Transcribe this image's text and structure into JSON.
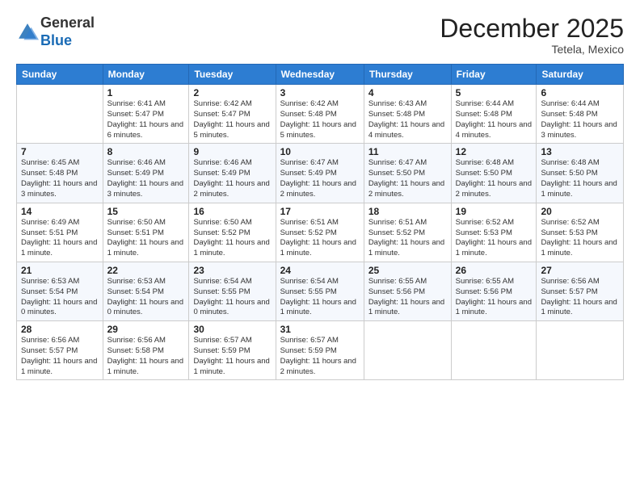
{
  "logo": {
    "general": "General",
    "blue": "Blue"
  },
  "header": {
    "month": "December 2025",
    "location": "Tetela, Mexico"
  },
  "weekdays": [
    "Sunday",
    "Monday",
    "Tuesday",
    "Wednesday",
    "Thursday",
    "Friday",
    "Saturday"
  ],
  "weeks": [
    [
      {
        "day": "",
        "sunrise": "",
        "sunset": "",
        "daylight": ""
      },
      {
        "day": "1",
        "sunrise": "Sunrise: 6:41 AM",
        "sunset": "Sunset: 5:47 PM",
        "daylight": "Daylight: 11 hours and 6 minutes."
      },
      {
        "day": "2",
        "sunrise": "Sunrise: 6:42 AM",
        "sunset": "Sunset: 5:47 PM",
        "daylight": "Daylight: 11 hours and 5 minutes."
      },
      {
        "day": "3",
        "sunrise": "Sunrise: 6:42 AM",
        "sunset": "Sunset: 5:48 PM",
        "daylight": "Daylight: 11 hours and 5 minutes."
      },
      {
        "day": "4",
        "sunrise": "Sunrise: 6:43 AM",
        "sunset": "Sunset: 5:48 PM",
        "daylight": "Daylight: 11 hours and 4 minutes."
      },
      {
        "day": "5",
        "sunrise": "Sunrise: 6:44 AM",
        "sunset": "Sunset: 5:48 PM",
        "daylight": "Daylight: 11 hours and 4 minutes."
      },
      {
        "day": "6",
        "sunrise": "Sunrise: 6:44 AM",
        "sunset": "Sunset: 5:48 PM",
        "daylight": "Daylight: 11 hours and 3 minutes."
      }
    ],
    [
      {
        "day": "7",
        "sunrise": "Sunrise: 6:45 AM",
        "sunset": "Sunset: 5:48 PM",
        "daylight": "Daylight: 11 hours and 3 minutes."
      },
      {
        "day": "8",
        "sunrise": "Sunrise: 6:46 AM",
        "sunset": "Sunset: 5:49 PM",
        "daylight": "Daylight: 11 hours and 3 minutes."
      },
      {
        "day": "9",
        "sunrise": "Sunrise: 6:46 AM",
        "sunset": "Sunset: 5:49 PM",
        "daylight": "Daylight: 11 hours and 2 minutes."
      },
      {
        "day": "10",
        "sunrise": "Sunrise: 6:47 AM",
        "sunset": "Sunset: 5:49 PM",
        "daylight": "Daylight: 11 hours and 2 minutes."
      },
      {
        "day": "11",
        "sunrise": "Sunrise: 6:47 AM",
        "sunset": "Sunset: 5:50 PM",
        "daylight": "Daylight: 11 hours and 2 minutes."
      },
      {
        "day": "12",
        "sunrise": "Sunrise: 6:48 AM",
        "sunset": "Sunset: 5:50 PM",
        "daylight": "Daylight: 11 hours and 2 minutes."
      },
      {
        "day": "13",
        "sunrise": "Sunrise: 6:48 AM",
        "sunset": "Sunset: 5:50 PM",
        "daylight": "Daylight: 11 hours and 1 minute."
      }
    ],
    [
      {
        "day": "14",
        "sunrise": "Sunrise: 6:49 AM",
        "sunset": "Sunset: 5:51 PM",
        "daylight": "Daylight: 11 hours and 1 minute."
      },
      {
        "day": "15",
        "sunrise": "Sunrise: 6:50 AM",
        "sunset": "Sunset: 5:51 PM",
        "daylight": "Daylight: 11 hours and 1 minute."
      },
      {
        "day": "16",
        "sunrise": "Sunrise: 6:50 AM",
        "sunset": "Sunset: 5:52 PM",
        "daylight": "Daylight: 11 hours and 1 minute."
      },
      {
        "day": "17",
        "sunrise": "Sunrise: 6:51 AM",
        "sunset": "Sunset: 5:52 PM",
        "daylight": "Daylight: 11 hours and 1 minute."
      },
      {
        "day": "18",
        "sunrise": "Sunrise: 6:51 AM",
        "sunset": "Sunset: 5:52 PM",
        "daylight": "Daylight: 11 hours and 1 minute."
      },
      {
        "day": "19",
        "sunrise": "Sunrise: 6:52 AM",
        "sunset": "Sunset: 5:53 PM",
        "daylight": "Daylight: 11 hours and 1 minute."
      },
      {
        "day": "20",
        "sunrise": "Sunrise: 6:52 AM",
        "sunset": "Sunset: 5:53 PM",
        "daylight": "Daylight: 11 hours and 1 minute."
      }
    ],
    [
      {
        "day": "21",
        "sunrise": "Sunrise: 6:53 AM",
        "sunset": "Sunset: 5:54 PM",
        "daylight": "Daylight: 11 hours and 0 minutes."
      },
      {
        "day": "22",
        "sunrise": "Sunrise: 6:53 AM",
        "sunset": "Sunset: 5:54 PM",
        "daylight": "Daylight: 11 hours and 0 minutes."
      },
      {
        "day": "23",
        "sunrise": "Sunrise: 6:54 AM",
        "sunset": "Sunset: 5:55 PM",
        "daylight": "Daylight: 11 hours and 0 minutes."
      },
      {
        "day": "24",
        "sunrise": "Sunrise: 6:54 AM",
        "sunset": "Sunset: 5:55 PM",
        "daylight": "Daylight: 11 hours and 1 minute."
      },
      {
        "day": "25",
        "sunrise": "Sunrise: 6:55 AM",
        "sunset": "Sunset: 5:56 PM",
        "daylight": "Daylight: 11 hours and 1 minute."
      },
      {
        "day": "26",
        "sunrise": "Sunrise: 6:55 AM",
        "sunset": "Sunset: 5:56 PM",
        "daylight": "Daylight: 11 hours and 1 minute."
      },
      {
        "day": "27",
        "sunrise": "Sunrise: 6:56 AM",
        "sunset": "Sunset: 5:57 PM",
        "daylight": "Daylight: 11 hours and 1 minute."
      }
    ],
    [
      {
        "day": "28",
        "sunrise": "Sunrise: 6:56 AM",
        "sunset": "Sunset: 5:57 PM",
        "daylight": "Daylight: 11 hours and 1 minute."
      },
      {
        "day": "29",
        "sunrise": "Sunrise: 6:56 AM",
        "sunset": "Sunset: 5:58 PM",
        "daylight": "Daylight: 11 hours and 1 minute."
      },
      {
        "day": "30",
        "sunrise": "Sunrise: 6:57 AM",
        "sunset": "Sunset: 5:59 PM",
        "daylight": "Daylight: 11 hours and 1 minute."
      },
      {
        "day": "31",
        "sunrise": "Sunrise: 6:57 AM",
        "sunset": "Sunset: 5:59 PM",
        "daylight": "Daylight: 11 hours and 2 minutes."
      },
      {
        "day": "",
        "sunrise": "",
        "sunset": "",
        "daylight": ""
      },
      {
        "day": "",
        "sunrise": "",
        "sunset": "",
        "daylight": ""
      },
      {
        "day": "",
        "sunrise": "",
        "sunset": "",
        "daylight": ""
      }
    ]
  ]
}
